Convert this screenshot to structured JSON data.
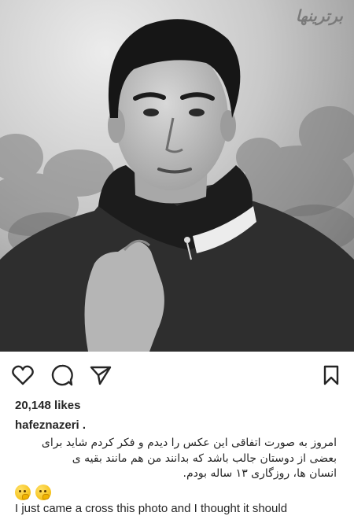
{
  "post": {
    "photo_alt": "",
    "watermark": "برترینها",
    "actions": {
      "like_icon": "heart-outline-icon",
      "comment_icon": "comment-bubble-icon",
      "share_icon": "paper-plane-icon",
      "save_icon": "bookmark-outline-icon"
    },
    "likes_text": "20,148 likes",
    "username": "hafeznazeri",
    "username_suffix": " .",
    "caption_fa_lines": [
      "امروز به صورت اتفاقی این عکس را دیدم و فکر کردم شاید برای",
      "بعضی از دوستان جالب باشد که بدانند من هم مانند بقیه ی",
      "انسان ها، روزگاری ۱۳ ساله بودم."
    ],
    "emojis": [
      "thinking-face-emoji",
      "thinking-face-emoji"
    ],
    "caption_en": "I just came a cross this photo and I thought it should"
  },
  "colors": {
    "text": "#262626",
    "background": "#ffffff",
    "icon": "#262626"
  }
}
